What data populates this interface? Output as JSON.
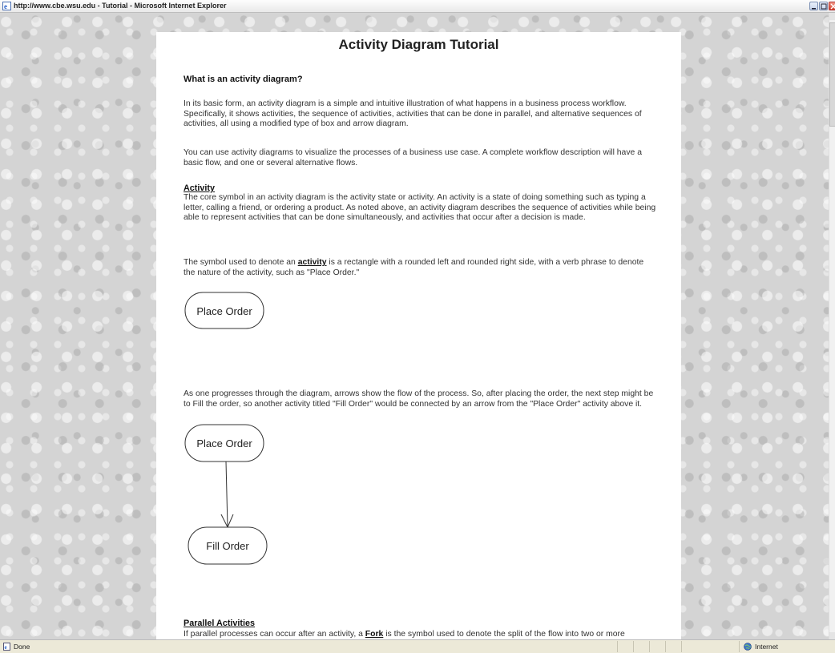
{
  "window": {
    "title": "http://www.cbe.wsu.edu - Tutorial - Microsoft Internet Explorer"
  },
  "page": {
    "title": "Activity Diagram Tutorial",
    "intro_heading": "What is an activity diagram?",
    "intro_p1": "In its basic form, an activity diagram is a simple and intuitive illustration of what happens in a business process workflow.  Specifically, it shows activities, the sequence of activities, activities that can be done in parallel, and alternative sequences of activities, all using a modified type of box and arrow diagram.",
    "intro_p2": "You can use activity diagrams to visualize the processes of a business use case. A complete workflow description will have a basic flow, and one or several alternative flows.",
    "activity_title": "Activity",
    "activity_p1": "The core symbol in an activity diagram is the activity state or activity. An activity is a state of doing something such as typing a letter, calling a friend, or ordering a product.  As noted above, an activity diagram describes the sequence of activities while being able to represent activities that can be done simultaneously, and activities that occur after a decision is made.",
    "activity_p2_before": "The symbol used to denote an ",
    "activity_p2_term": "activity",
    "activity_p2_after": " is a rectangle with a rounded left and rounded right side, with a verb phrase to denote the nature of the activity, such as \"Place Order.\"",
    "diagram1_label": "Place Order",
    "flow_p": "As one progresses through the diagram, arrows show the flow of the process.  So, after placing the order, the next step might be to Fill the order, so another activity titled \"Fill Order\" would be connected by an arrow from the \"Place Order\" activity above it.",
    "diagram2_label_top": "Place Order",
    "diagram2_label_bottom": "Fill Order",
    "parallel_title": "Parallel Activities",
    "parallel_p_before": "If parallel processes can occur after an activity, a ",
    "parallel_p_term": "Fork",
    "parallel_p_after": " is the symbol used to denote the split of the flow into two or more simultaneous processes.  The symbol used to denote a Fork is a short, bold horizontal"
  },
  "statusbar": {
    "status": "Done",
    "zone": "Internet"
  }
}
